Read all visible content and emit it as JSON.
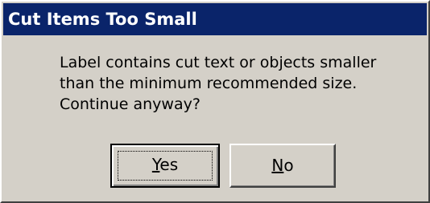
{
  "dialog": {
    "title": "Cut Items Too Small",
    "message_lines": [
      "Label contains cut text or objects smaller",
      "than the minimum recommended size.",
      "Continue anyway?"
    ],
    "buttons": {
      "yes": {
        "mnemonic": "Y",
        "rest": "es",
        "label": "Yes"
      },
      "no": {
        "mnemonic": "N",
        "rest": "o",
        "label": "No"
      }
    },
    "colors": {
      "title_bar": "#0a246a",
      "title_text": "#ffffff",
      "face": "#d4d0c8"
    }
  }
}
